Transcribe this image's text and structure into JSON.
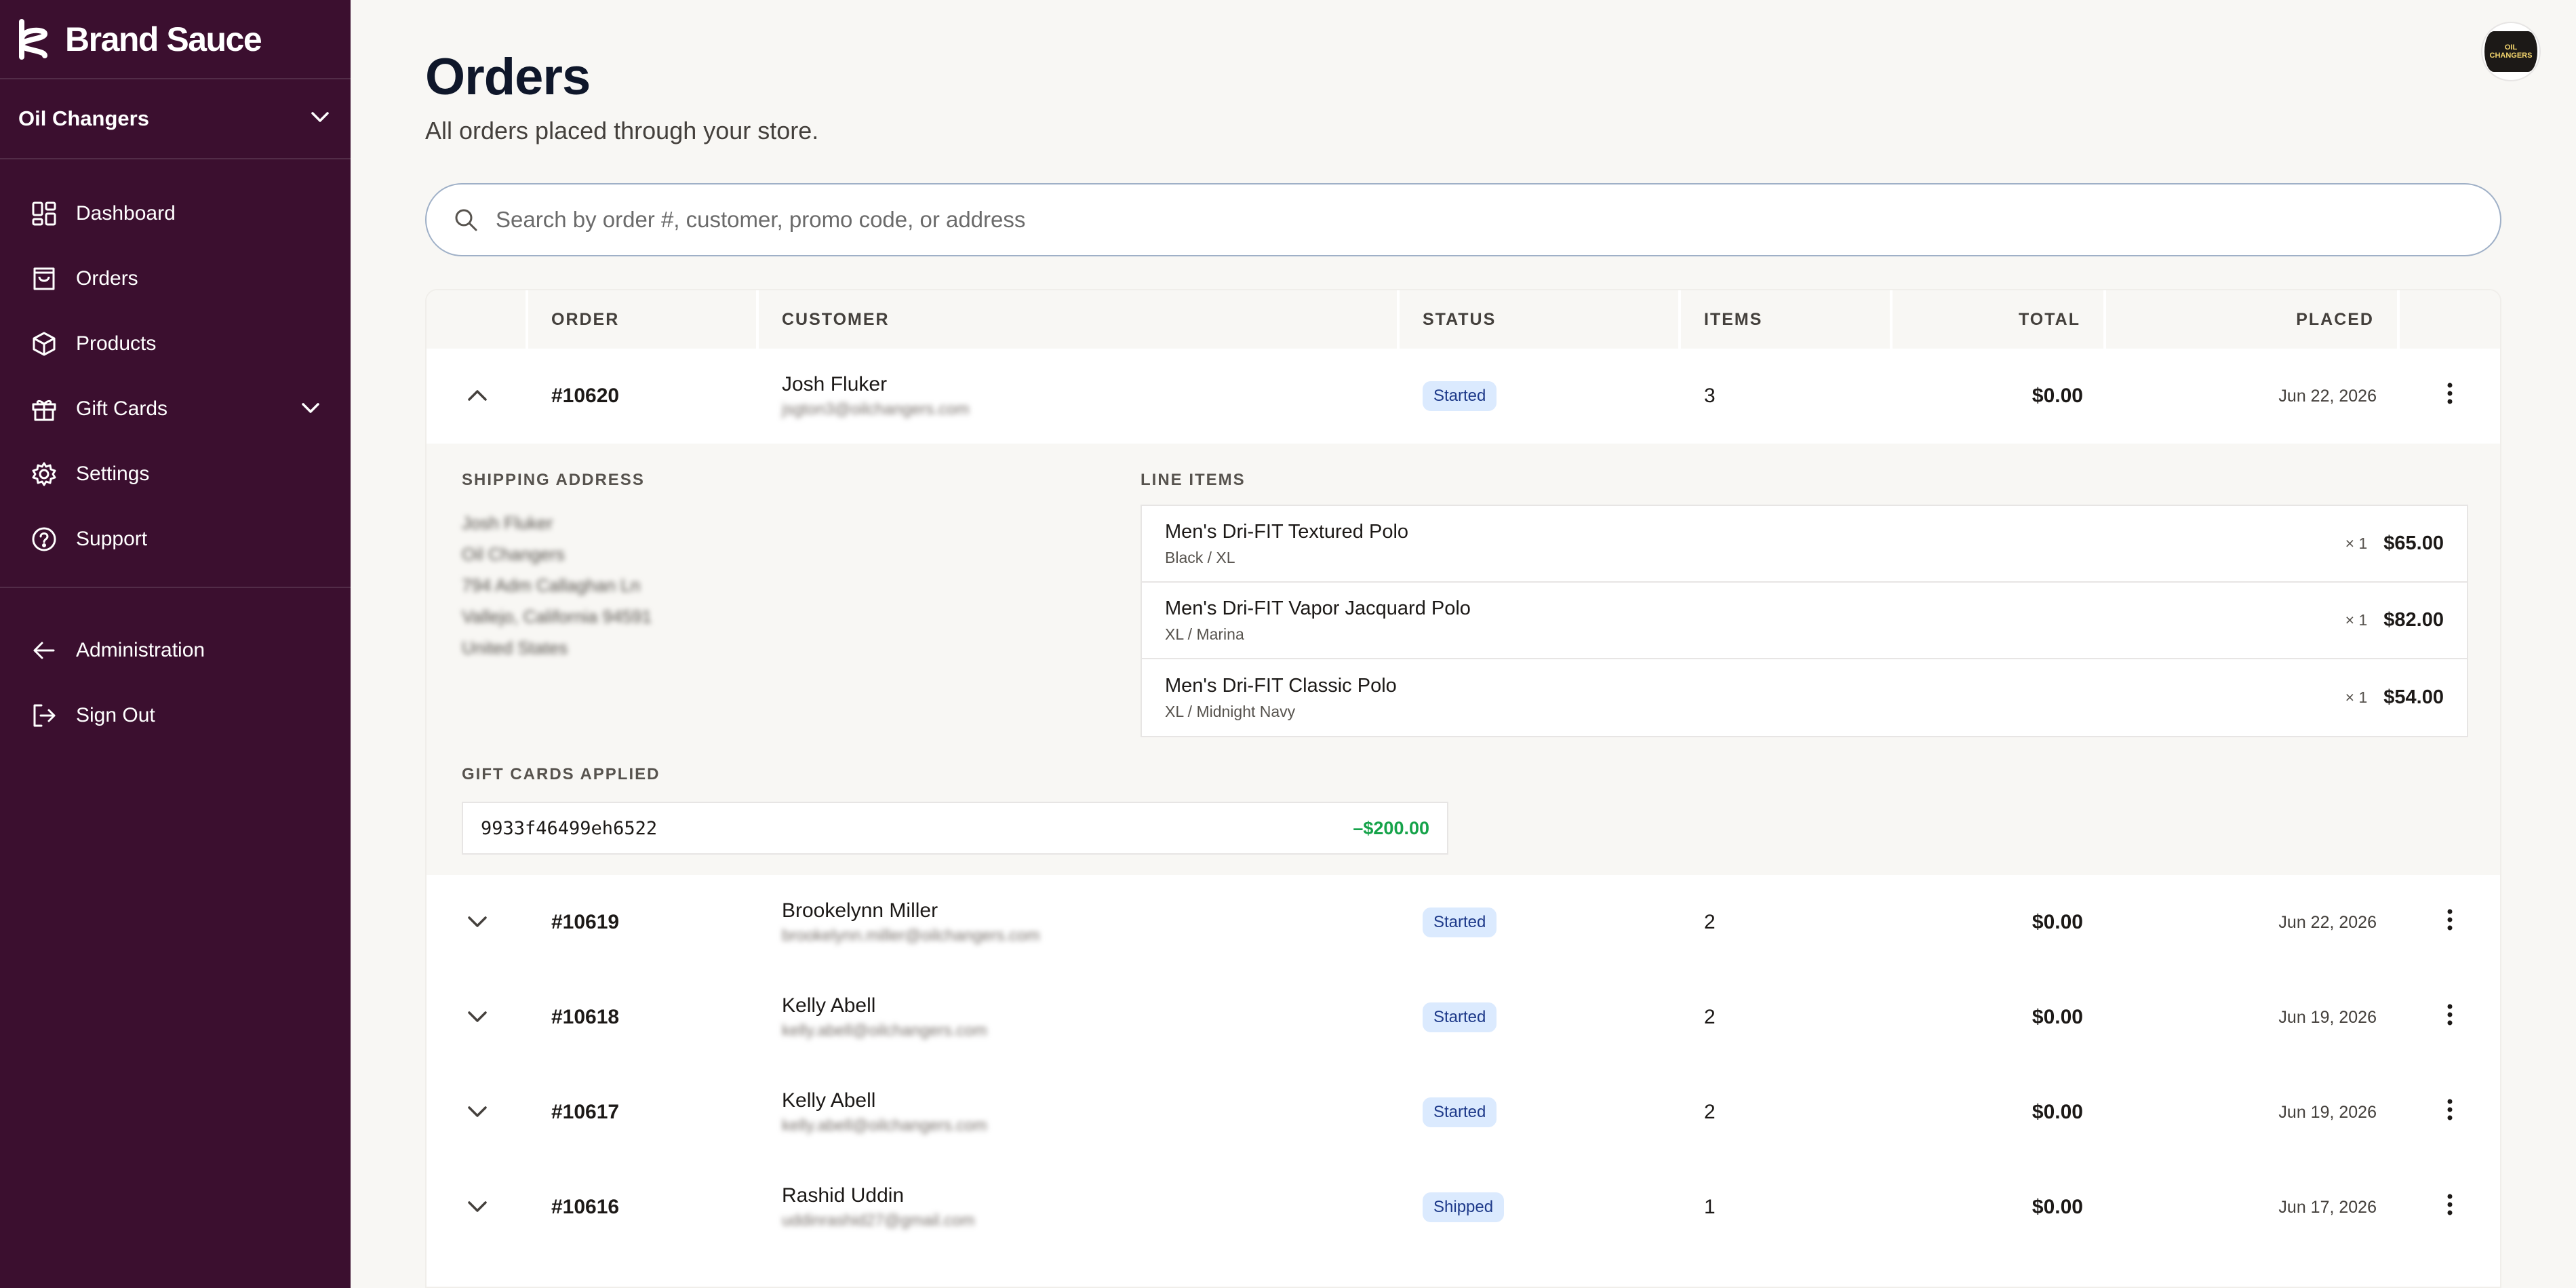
{
  "brand": {
    "name": "Brand Sauce"
  },
  "store": {
    "name": "Oil Changers"
  },
  "sidebar": {
    "items": [
      {
        "label": "Dashboard",
        "icon": "dashboard-icon"
      },
      {
        "label": "Orders",
        "icon": "shopping-bag-icon"
      },
      {
        "label": "Products",
        "icon": "box-icon"
      },
      {
        "label": "Gift Cards",
        "icon": "gift-icon"
      },
      {
        "label": "Settings",
        "icon": "gear-icon"
      },
      {
        "label": "Support",
        "icon": "help-circle-icon"
      }
    ],
    "footer": [
      {
        "label": "Administration",
        "icon": "arrow-left-icon"
      },
      {
        "label": "Sign Out",
        "icon": "sign-out-icon"
      }
    ]
  },
  "avatar": {
    "text": "OIL CHANGERS"
  },
  "page": {
    "title": "Orders",
    "subtitle": "All orders placed through your store."
  },
  "search": {
    "placeholder": "Search by order #, customer, promo code, or address",
    "value": ""
  },
  "table": {
    "headers": [
      "ORDER",
      "CUSTOMER",
      "STATUS",
      "ITEMS",
      "TOTAL",
      "PLACED"
    ],
    "rows": [
      {
        "order": "#10620",
        "name": "Josh Fluker",
        "email": "jsgton3@oilchangers.com",
        "status": "Started",
        "items": "3",
        "total": "$0.00",
        "placed": "Jun 22, 2026"
      },
      {
        "order": "#10619",
        "name": "Brookelynn Miller",
        "email": "brookelynn.miller@oilchangers.com",
        "status": "Started",
        "items": "2",
        "total": "$0.00",
        "placed": "Jun 22, 2026"
      },
      {
        "order": "#10618",
        "name": "Kelly Abell",
        "email": "kelly.abell@oilchangers.com",
        "status": "Started",
        "items": "2",
        "total": "$0.00",
        "placed": "Jun 19, 2026"
      },
      {
        "order": "#10617",
        "name": "Kelly Abell",
        "email": "kelly.abell@oilchangers.com",
        "status": "Started",
        "items": "2",
        "total": "$0.00",
        "placed": "Jun 19, 2026"
      },
      {
        "order": "#10616",
        "name": "Rashid Uddin",
        "email": "uddinrashid27@gmail.com",
        "status": "Shipped",
        "items": "1",
        "total": "$0.00",
        "placed": "Jun 17, 2026"
      }
    ]
  },
  "detail": {
    "shipping_label": "SHIPPING ADDRESS",
    "address": [
      "Josh Fluker",
      "Oil Changers",
      "794 Adm Callaghan Ln",
      "Vallejo, California 94591",
      "United States"
    ],
    "line_items_label": "LINE ITEMS",
    "line_items": [
      {
        "name": "Men's Dri-FIT Textured Polo",
        "variant": "Black / XL",
        "qty": "× 1",
        "price": "$65.00"
      },
      {
        "name": "Men's Dri-FIT Vapor Jacquard Polo",
        "variant": "XL / Marina",
        "qty": "× 1",
        "price": "$82.00"
      },
      {
        "name": "Men's Dri-FIT Classic Polo",
        "variant": "XL / Midnight Navy",
        "qty": "× 1",
        "price": "$54.00"
      }
    ],
    "gift_label": "GIFT CARDS APPLIED",
    "gift_code": "9933f46499eh6522",
    "gift_amount": "–$200.00"
  },
  "colors": {
    "sidebar": "#3b0f2f",
    "badge_bg": "#dbeafe",
    "gift_amount": "#16a34a"
  }
}
